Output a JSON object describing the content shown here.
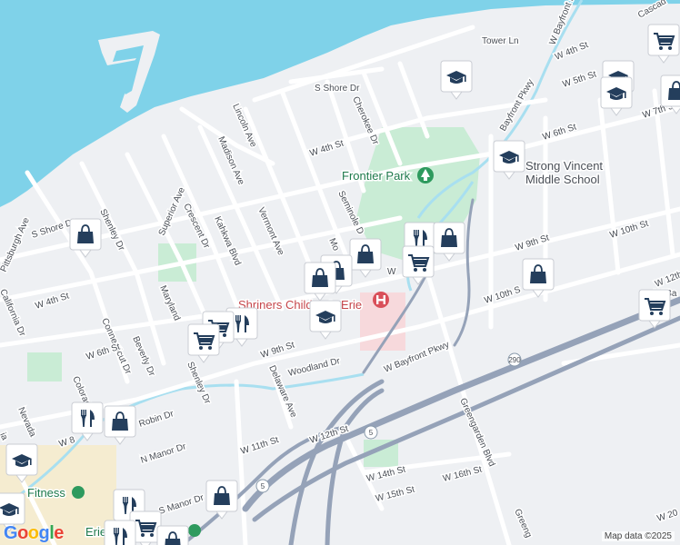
{
  "map": {
    "water_color": "#7fd2e9",
    "land_color": "#eef0f3",
    "park_color": "#c9ecd5",
    "road_color": "#ffffff",
    "highway_color": "#95a2b8",
    "stream_color": "#a8dff0"
  },
  "streets": {
    "w_bayfront_pkwy_top": "W Bayfront Pkwy",
    "bayfront_pkwy": "Bayfront Pkwy",
    "tower_ln": "Tower Ln",
    "w_4th_st_ne": "W 4th St",
    "w_5th_st": "W 5th St",
    "w_7th_st": "W 7th S",
    "cascade": "Cascad",
    "s_shore_dr_top": "S Shore Dr",
    "cherokee_dr": "Cherokee Dr",
    "lincoln_ave": "Lincoln Ave",
    "madison_ave": "Madison Ave",
    "w_4th_st_mid": "W 4th St",
    "w_6th_st_east": "W 6th St",
    "seminole_dr": "Seminole D",
    "superior_ave": "Superior Ave",
    "crescent_dr": "Crescent Dr",
    "vermont_ave": "Vermont Ave",
    "kahkwa_blvd": "Kahkwa Blvd",
    "s_shore_dr_left": "S Shore Dr",
    "shenley_dr_top": "Shenley Dr",
    "mo": "Mo",
    "w_9th_st_east": "W 9th St",
    "w_10th_st_east": "W 10th St",
    "w_10th_s": "W 10th S",
    "w_12th_east": "W 12th",
    "pittsburgh_ave": "Pittsburgh Ave",
    "w_4th_st_left": "W 4th St",
    "california_dr": "California Dr",
    "maryland": "Maryland",
    "connecticut_dr": "Connecticut Dr",
    "w_6th_st_left": "W 6th St",
    "beverly_dr": "Beverly Dr",
    "w_9th_st_mid": "W 9th St",
    "woodland_dr": "Woodland Dr",
    "w_bayfront_pkwy_low": "W Bayfront Pkwy",
    "i290": "290",
    "shenley_dr_low": "Shenley Dr",
    "delaware_ave": "Delaware Ave",
    "colorado_dr": "Colorado Dr",
    "robin_dr": "Robin Dr",
    "w_8": "W 8",
    "nevada": "Nevada",
    "w_12th_st": "W 12th St",
    "greengarden_blvd": "Greengarden Blvd",
    "w_11th_st": "W 11th St",
    "n_manor_dr": "N Manor Dr",
    "s_manor_dr": "S Manor Dr",
    "rt5_a": "5",
    "rt5_b": "5",
    "w_14th_st": "W 14th St",
    "w_15th_st": "W 15th St",
    "w_16th_st": "W 16th St",
    "greeng": "Greeng",
    "w_20": "W 20",
    "w": "W",
    "ia": "ia",
    "w_ba": "W Ba"
  },
  "places": {
    "frontier_park": "Frontier Park",
    "strong_vincent_line1": "Strong Vincent",
    "strong_vincent_line2": "Middle School",
    "shriners": "Shriners Children's Erie",
    "fitness": "Fitness",
    "erie": "Erie"
  },
  "icons": {
    "school": "school-icon",
    "shopping": "shopping-bag-icon",
    "grocery": "shopping-cart-icon",
    "restaurant": "restaurant-icon",
    "park": "park-icon",
    "hospital": "hospital-icon"
  },
  "attribution": {
    "logo": "Google",
    "logo_colors": [
      "#4285F4",
      "#EA4335",
      "#FBBC05",
      "#4285F4",
      "#34A853",
      "#EA4335"
    ],
    "credit": "Map data ©2025"
  }
}
